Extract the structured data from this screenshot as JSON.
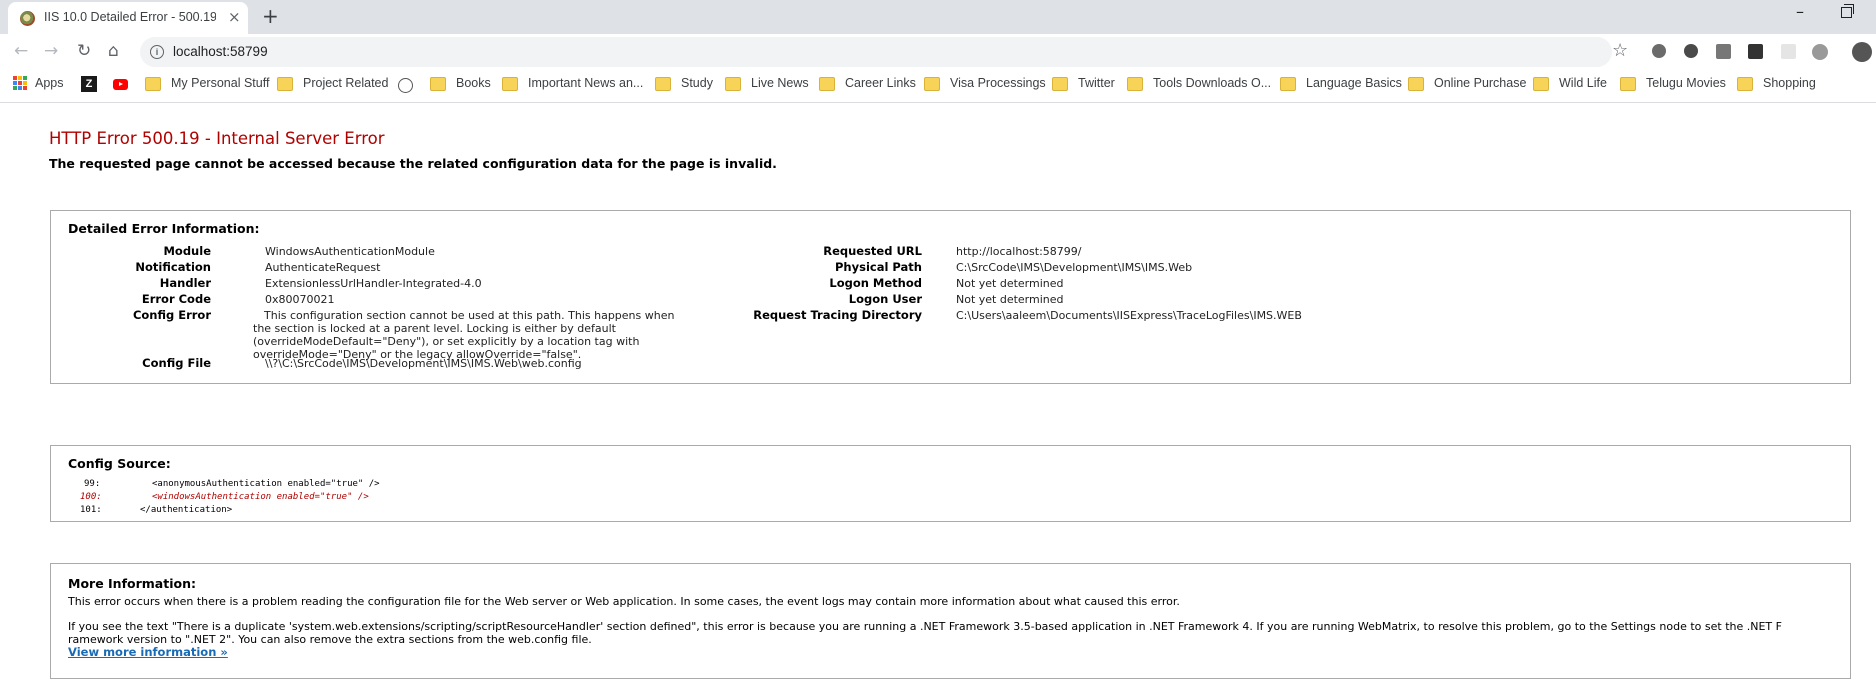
{
  "browser": {
    "tab_title": "IIS 10.0 Detailed Error - 500.19 -",
    "tab_close": "×",
    "new_tab": "+",
    "url": "localhost:58799",
    "bookmarks": [
      {
        "label": "Apps",
        "type": "apps"
      },
      {
        "label": "",
        "type": "z"
      },
      {
        "label": "",
        "type": "youtube"
      },
      {
        "label": "My Personal Stuff",
        "type": "folder"
      },
      {
        "label": "Project Related",
        "type": "folder"
      },
      {
        "label": "",
        "type": "globe"
      },
      {
        "label": "Books",
        "type": "folder"
      },
      {
        "label": "Important News an...",
        "type": "folder"
      },
      {
        "label": "Study",
        "type": "folder"
      },
      {
        "label": "Live News",
        "type": "folder"
      },
      {
        "label": "Career Links",
        "type": "folder"
      },
      {
        "label": "Visa Processings",
        "type": "folder"
      },
      {
        "label": "Twitter",
        "type": "folder"
      },
      {
        "label": "Tools Downloads O...",
        "type": "folder"
      },
      {
        "label": "Language Basics",
        "type": "folder"
      },
      {
        "label": "Online Purchase",
        "type": "folder"
      },
      {
        "label": "Wild Life",
        "type": "folder"
      },
      {
        "label": "Telugu Movies",
        "type": "folder"
      },
      {
        "label": "Shopping",
        "type": "folder"
      }
    ]
  },
  "page": {
    "heading": "HTTP Error 500.19 - Internal Server Error",
    "subheading": "The requested page cannot be accessed because the related configuration data for the page is invalid.",
    "detailed": {
      "title": "Detailed Error Information:",
      "left": [
        {
          "label": "Module",
          "value": "WindowsAuthenticationModule"
        },
        {
          "label": "Notification",
          "value": "AuthenticateRequest"
        },
        {
          "label": "Handler",
          "value": "ExtensionlessUrlHandler-Integrated-4.0"
        },
        {
          "label": "Error Code",
          "value": "0x80070021"
        },
        {
          "label": "Config Error",
          "value": "This configuration section cannot be used at this path. This happens when the section is locked at a parent level. Locking is either by default (overrideModeDefault=\"Deny\"), or set explicitly by a location tag with overrideMode=\"Deny\" or the legacy allowOverride=\"false\"."
        },
        {
          "label": "Config File",
          "value": "\\\\?\\C:\\SrcCode\\IMS\\Development\\IMS\\IMS.Web\\web.config"
        }
      ],
      "right": [
        {
          "label": "Requested URL",
          "value": "http://localhost:58799/"
        },
        {
          "label": "Physical Path",
          "value": "C:\\SrcCode\\IMS\\Development\\IMS\\IMS.Web"
        },
        {
          "label": "Logon Method",
          "value": "Not yet determined"
        },
        {
          "label": "Logon User",
          "value": "Not yet determined"
        },
        {
          "label": "Request Tracing Directory",
          "value": "C:\\Users\\aaleem\\Documents\\IISExpress\\TraceLogFiles\\IMS.WEB"
        }
      ]
    },
    "config_source": {
      "title": "Config Source:",
      "lines": [
        {
          "num": "99:",
          "code": "<anonymousAuthentication enabled=\"true\" />",
          "error": false
        },
        {
          "num": "100:",
          "code": "<windowsAuthentication enabled=\"true\" />",
          "error": true
        },
        {
          "num": "101:",
          "code": "</authentication>",
          "error": false
        }
      ]
    },
    "more_info": {
      "title": "More Information:",
      "p1": "This error occurs when there is a problem reading the configuration file for the Web server or Web application. In some cases, the event logs may contain more information about what caused this error.",
      "p2a": "If you see the text \"There is a duplicate 'system.web.extensions/scripting/scriptResourceHandler' section defined\", this error is because you are running a .NET Framework 3.5-based application in .NET Framework 4. If you are running WebMatrix, to resolve this problem, go to the Settings node to set the .NET F",
      "p2b": "ramework version to \".NET 2\". You can also remove the extra sections from the web.config file.",
      "link": "View more information »"
    }
  },
  "colors": {
    "error_red": "#b10000",
    "link_blue": "#1a6bb5"
  }
}
